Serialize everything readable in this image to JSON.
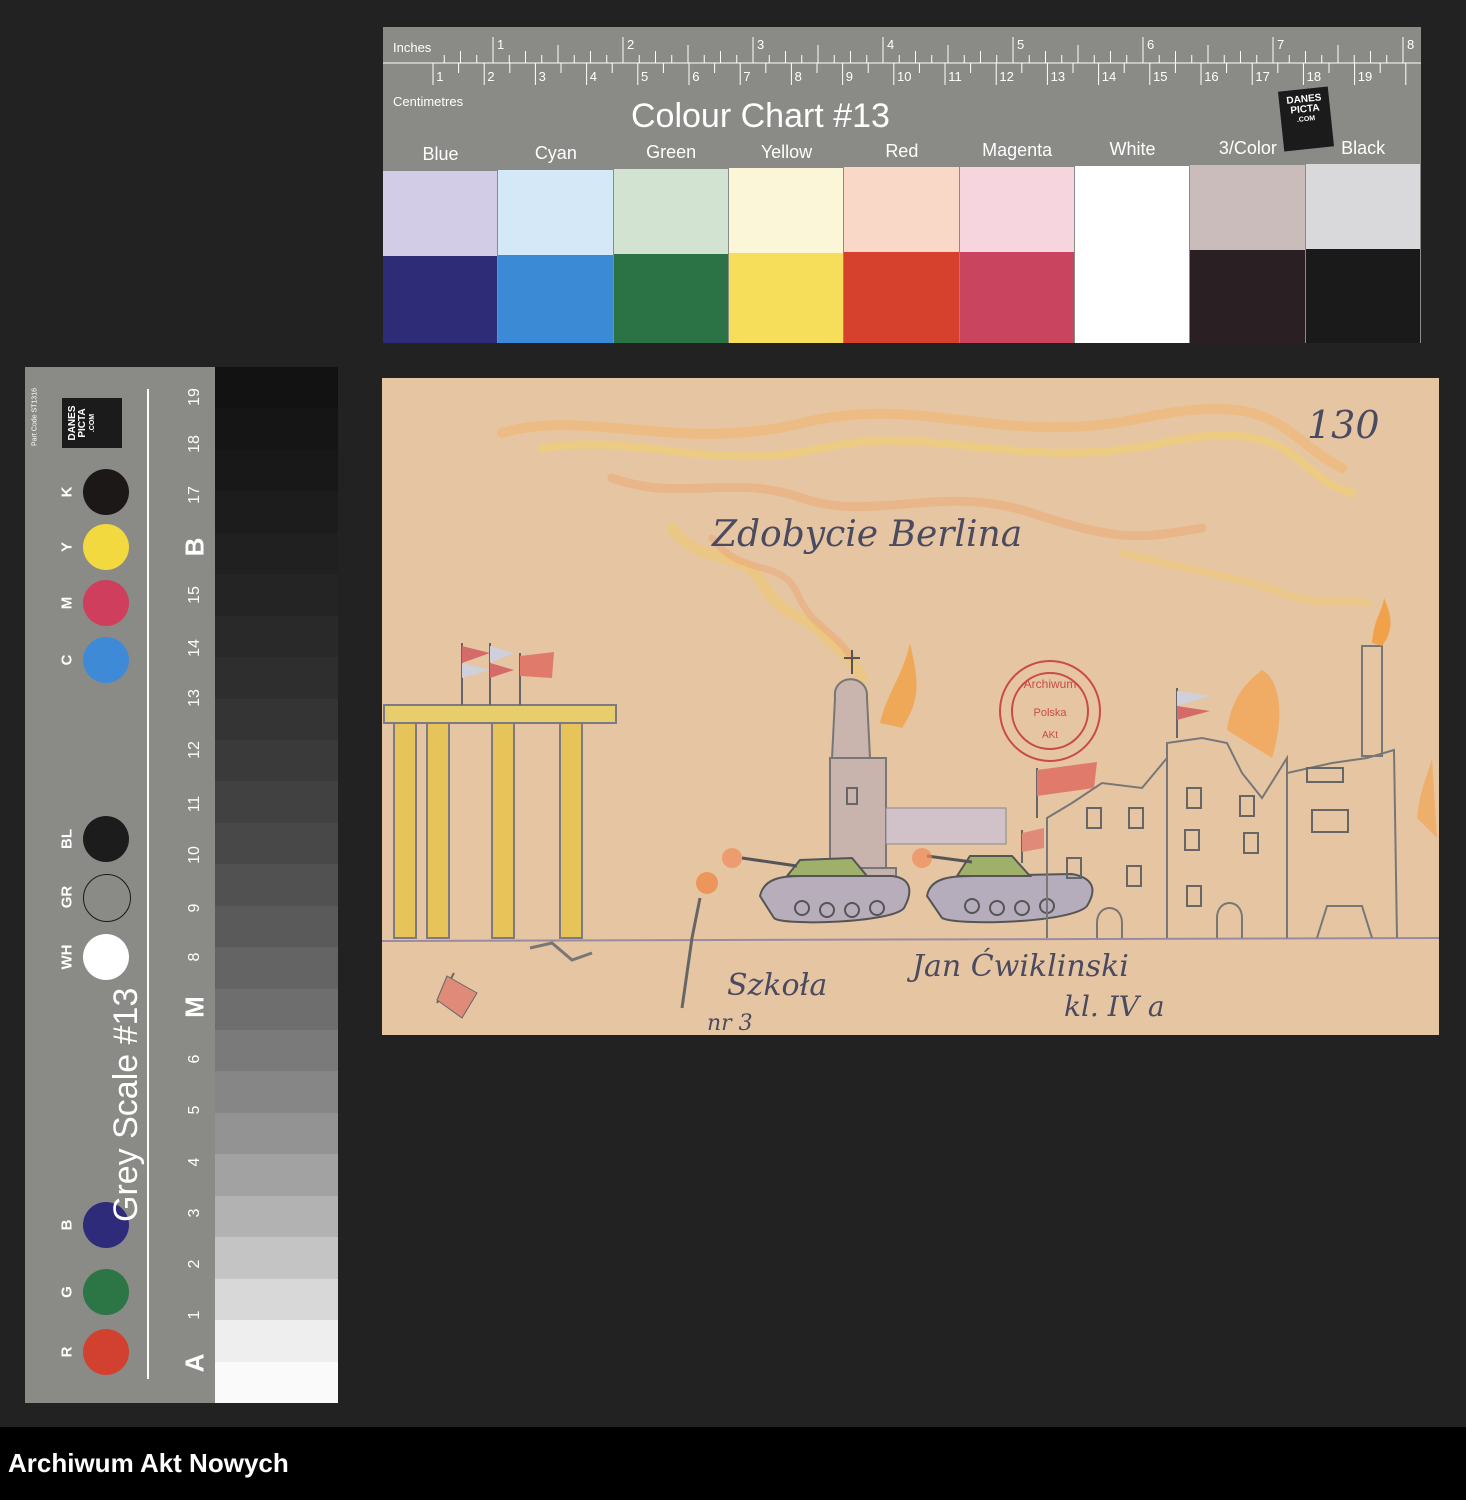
{
  "colour_chart": {
    "title": "Colour Chart #13",
    "inches_label": "Inches",
    "centimetres_label": "Centimetres",
    "inch_numbers": [
      "1",
      "2",
      "3",
      "4",
      "5",
      "6",
      "7",
      "8"
    ],
    "cm_numbers": [
      "1",
      "2",
      "3",
      "4",
      "5",
      "6",
      "7",
      "8",
      "9",
      "10",
      "11",
      "12",
      "13",
      "14",
      "15",
      "16",
      "17",
      "18",
      "19"
    ],
    "logo": [
      "DANES",
      "PICTA",
      ".COM"
    ],
    "columns": [
      {
        "name": "Blue",
        "light": "#d2cce6",
        "dark": "#2e2b77"
      },
      {
        "name": "Cyan",
        "light": "#d5e8f7",
        "dark": "#3a8ad6"
      },
      {
        "name": "Green",
        "light": "#d2e3d2",
        "dark": "#2b7345"
      },
      {
        "name": "Yellow",
        "light": "#fcf6d8",
        "dark": "#f7de5a"
      },
      {
        "name": "Red",
        "light": "#f9d8c8",
        "dark": "#d5412c"
      },
      {
        "name": "Magenta",
        "light": "#f6d5de",
        "dark": "#c8445f"
      },
      {
        "name": "White",
        "light": "#ffffff",
        "dark": "#ffffff"
      },
      {
        "name": "3/Color",
        "light": "#cbbcbc",
        "dark": "#2a1f22"
      },
      {
        "name": "Black",
        "light": "#d9d9db",
        "dark": "#1a1a1a"
      }
    ]
  },
  "grey_scale": {
    "title": "Grey Scale #13",
    "logo": [
      "DANES",
      "PICTA",
      ".COM"
    ],
    "part_code": "Part Code ST1316",
    "dots": [
      {
        "label": "K",
        "color": "#1d1818"
      },
      {
        "label": "Y",
        "color": "#f2d93f"
      },
      {
        "label": "M",
        "color": "#cf3e5c"
      },
      {
        "label": "C",
        "color": "#3f8ad6"
      },
      {
        "label": "BL",
        "color": "#1d1c1c"
      },
      {
        "label": "GR",
        "color": "#8a8a86"
      },
      {
        "label": "WH",
        "color": "#ffffff"
      },
      {
        "label": "B",
        "color": "#2e2b7a"
      },
      {
        "label": "G",
        "color": "#2c7545"
      },
      {
        "label": "R",
        "color": "#d2402f"
      }
    ],
    "letters": [
      "B",
      "M",
      "A"
    ],
    "numbers": [
      "19",
      "18",
      "17",
      "15",
      "14",
      "13",
      "12",
      "11",
      "10",
      "9",
      "8",
      "6",
      "5",
      "4",
      "3",
      "2",
      "1"
    ],
    "steps": [
      "#121212",
      "#151515",
      "#181818",
      "#1c1c1c",
      "#202020",
      "#242424",
      "#292929",
      "#2e2e2e",
      "#343434",
      "#3a3a3a",
      "#414141",
      "#484848",
      "#515151",
      "#5a5a5a",
      "#646464",
      "#6e6e6e",
      "#7a7a7a",
      "#868686",
      "#939393",
      "#a2a2a2",
      "#b2b2b2",
      "#c4c4c4",
      "#d8d8d8",
      "#eeeeee",
      "#fafafa"
    ]
  },
  "drawing": {
    "page_number": "130",
    "title": "Zdobycie Berlina",
    "school_line1": "Szkoła",
    "school_line2": "nr 3",
    "author": "Jan Ćwiklinski",
    "class": "kl. IV a",
    "stamp_lines": [
      "Archiwum",
      "Polska",
      "AKt"
    ]
  },
  "footer": {
    "label": "Archiwum Akt Nowych"
  }
}
